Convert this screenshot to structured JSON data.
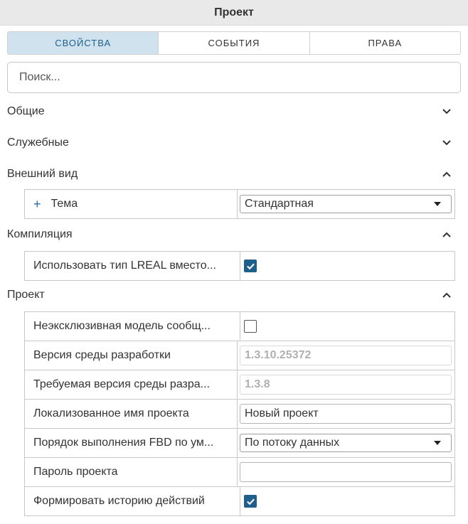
{
  "window": {
    "title": "Проект"
  },
  "tabs": [
    {
      "label": "СВОЙСТВА",
      "active": true
    },
    {
      "label": "СОБЫТИЯ",
      "active": false
    },
    {
      "label": "ПРАВА",
      "active": false
    }
  ],
  "search": {
    "placeholder": "Поиск..."
  },
  "sections": {
    "general": {
      "label": "Общие",
      "expanded": false
    },
    "service": {
      "label": "Служебные",
      "expanded": false
    },
    "appearance": {
      "label": "Внешний вид",
      "expanded": true
    },
    "compilation": {
      "label": "Компиляция",
      "expanded": true
    },
    "project": {
      "label": "Проект",
      "expanded": true
    }
  },
  "appearance": {
    "theme": {
      "label": "Тема",
      "value": "Стандартная"
    }
  },
  "compilation": {
    "use_lreal": {
      "label": "Использовать тип LREAL вместо...",
      "checked": true
    }
  },
  "project": {
    "non_exclusive": {
      "label": "Неэксклюзивная модель сообщ...",
      "checked": false
    },
    "ide_version": {
      "label": "Версия среды разработки",
      "value": "1.3.10.25372"
    },
    "required_ide_version": {
      "label": "Требуемая версия среды разра...",
      "value": "1.3.8"
    },
    "localized_name": {
      "label": "Локализованное имя проекта",
      "value": "Новый проект"
    },
    "fbd_order": {
      "label": "Порядок выполнения FBD по ум...",
      "value": "По потоку данных"
    },
    "password": {
      "label": "Пароль проекта",
      "value": ""
    },
    "history": {
      "label": "Формировать историю действий",
      "checked": true
    }
  },
  "colors": {
    "accent": "#1f5f8b",
    "active_tab_bg": "#cfe2ee",
    "titlebar_bg": "#e9e9e9"
  }
}
